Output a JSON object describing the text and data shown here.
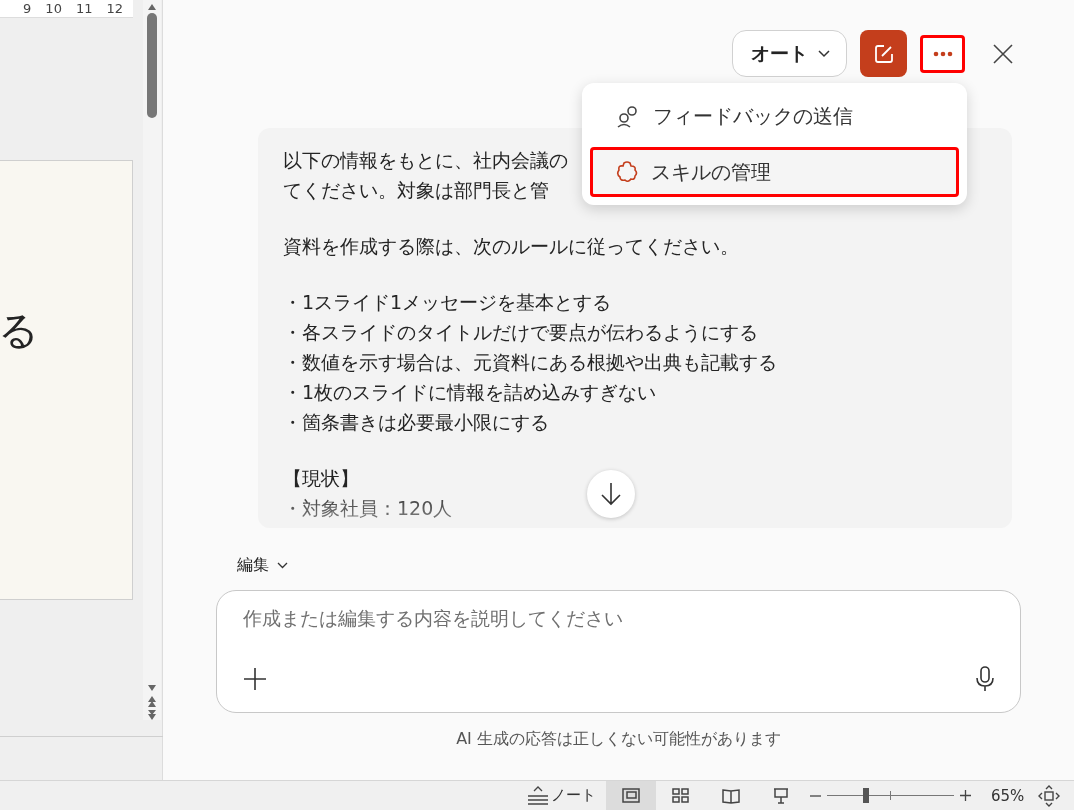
{
  "slide_pane": {
    "ruler_labels": [
      "9",
      "10",
      "11",
      "12"
    ],
    "slide_text": "る"
  },
  "copilot": {
    "mode_button": "オート",
    "more_button": {
      "highlighted": true
    },
    "menu": [
      {
        "label": "フィードバックの送信",
        "kind": "feedback",
        "highlighted": false
      },
      {
        "label": "スキルの管理",
        "kind": "skills",
        "highlighted": true
      }
    ],
    "message": [
      {
        "lines": [
          "以下の情報をもとに、社内会議の",
          "てください。対象は部門長と管"
        ]
      },
      {
        "lines": [
          "資料を作成する際は、次のルールに従ってください。"
        ]
      },
      {
        "lines": [
          "・1スライド1メッセージを基本とする",
          "・各スライドのタイトルだけで要点が伝わるようにする",
          "・数値を示す場合は、元資料にある根拠や出典も記載する",
          "・1枚のスライドに情報を詰め込みすぎない",
          "・箇条書きは必要最小限にする"
        ]
      },
      {
        "lines": [
          "【現状】",
          "・対象社員：120人"
        ]
      }
    ],
    "edit_menu": "編集",
    "input": {
      "placeholder": "作成または編集する内容を説明してください"
    },
    "disclaimer": "AI 生成の応答は正しくない可能性があります"
  },
  "status_bar": {
    "notes": "ノート",
    "views": [
      {
        "kind": "normal",
        "selected": true
      },
      {
        "kind": "sorter",
        "selected": false
      },
      {
        "kind": "reading",
        "selected": false
      },
      {
        "kind": "slideshow",
        "selected": false
      }
    ],
    "zoom": {
      "level": 0.31,
      "reading": "65%"
    }
  }
}
